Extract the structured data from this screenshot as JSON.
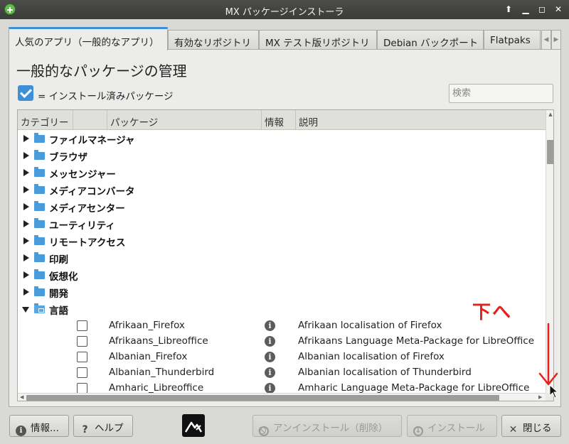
{
  "window": {
    "title": "MX パッケージインストーラ"
  },
  "tabs": [
    {
      "label": "人気のアプリ（一般的なアプリ）",
      "active": true
    },
    {
      "label": "有効なリポジトリ",
      "active": false
    },
    {
      "label": "MX テスト版リポジトリ",
      "active": false
    },
    {
      "label": "Debian バックポート",
      "active": false
    },
    {
      "label": "Flatpaks",
      "active": false
    }
  ],
  "page": {
    "heading": "一般的なパッケージの管理",
    "legend": "= インストール済みパッケージ",
    "search_placeholder": "検索"
  },
  "columns": {
    "category": "カテゴリー",
    "package": "パッケージ",
    "info": "情報",
    "description": "説明"
  },
  "categories": [
    {
      "label": "ファイルマネージャ",
      "expanded": false
    },
    {
      "label": "ブラウザ",
      "expanded": false
    },
    {
      "label": "メッセンジャー",
      "expanded": false
    },
    {
      "label": "メディアコンバータ",
      "expanded": false
    },
    {
      "label": "メディアセンター",
      "expanded": false
    },
    {
      "label": "ユーティリティ",
      "expanded": false
    },
    {
      "label": "リモートアクセス",
      "expanded": false
    },
    {
      "label": "印刷",
      "expanded": false
    },
    {
      "label": "仮想化",
      "expanded": false
    },
    {
      "label": "開発",
      "expanded": false
    },
    {
      "label": "言語",
      "expanded": true
    }
  ],
  "packages": [
    {
      "name": "Afrikaan_Firefox",
      "description": "Afrikaan localisation of Firefox",
      "installed": false
    },
    {
      "name": "Afrikaans_Libreoffice",
      "description": "Afrikaans Language Meta-Package for LibreOffice",
      "installed": false
    },
    {
      "name": "Albanian_Firefox",
      "description": "Albanian localisation of Firefox",
      "installed": false
    },
    {
      "name": "Albanian_Thunderbird",
      "description": "Albanian localisation of Thunderbird",
      "installed": false
    },
    {
      "name": "Amharic_Libreoffice",
      "description": "Amharic Language Meta-Package for LibreOffice",
      "installed": false
    }
  ],
  "annotation": {
    "text": "下へ",
    "color": "#e6201c"
  },
  "buttons": {
    "info": "情報...",
    "help": "ヘルプ",
    "uninstall": "アンインストール（削除）",
    "install": "インストール",
    "close": "閉じる"
  },
  "colors": {
    "accent": "#3d8fd6",
    "folder": "#4a9bd9"
  }
}
